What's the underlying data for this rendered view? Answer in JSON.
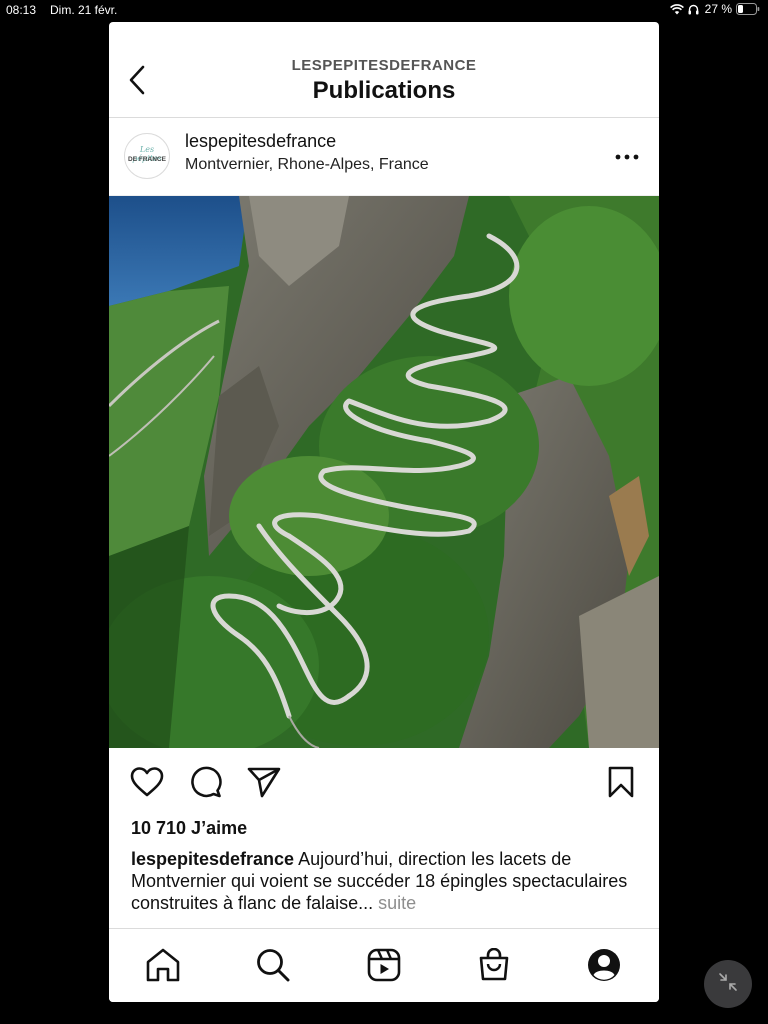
{
  "statusbar": {
    "time": "08:13",
    "date": "Dim. 21 févr.",
    "battery": "27 %"
  },
  "header": {
    "account": "LESPEPITESDEFRANCE",
    "title": "Publications"
  },
  "post": {
    "avatar_line1": "Les pépites",
    "avatar_line2": "DE FRANCE",
    "username": "lespepitesdefrance",
    "location": "Montvernier, Rhone-Alpes, France",
    "likes": "10 710 J’aime",
    "caption_user": "lespepitesdefrance",
    "caption_text": " Aujourd’hui, direction les lacets de Montvernier qui voient se succéder 18 épingles spectaculaires construites à flanc de falaise...",
    "caption_more": " suite"
  },
  "icons": {
    "back": "chevron-left-icon",
    "more": "more-horizontal-icon",
    "like": "heart-icon",
    "comment": "comment-icon",
    "share": "send-icon",
    "save": "bookmark-icon",
    "home": "home-icon",
    "search": "search-icon",
    "reels": "reels-icon",
    "shop": "shop-icon",
    "profile": "profile-icon",
    "collapse": "collapse-icon"
  },
  "colors": {
    "background": "#000000",
    "text": "#111111",
    "muted": "#8e8e8e",
    "divider": "#dbdbdb"
  }
}
